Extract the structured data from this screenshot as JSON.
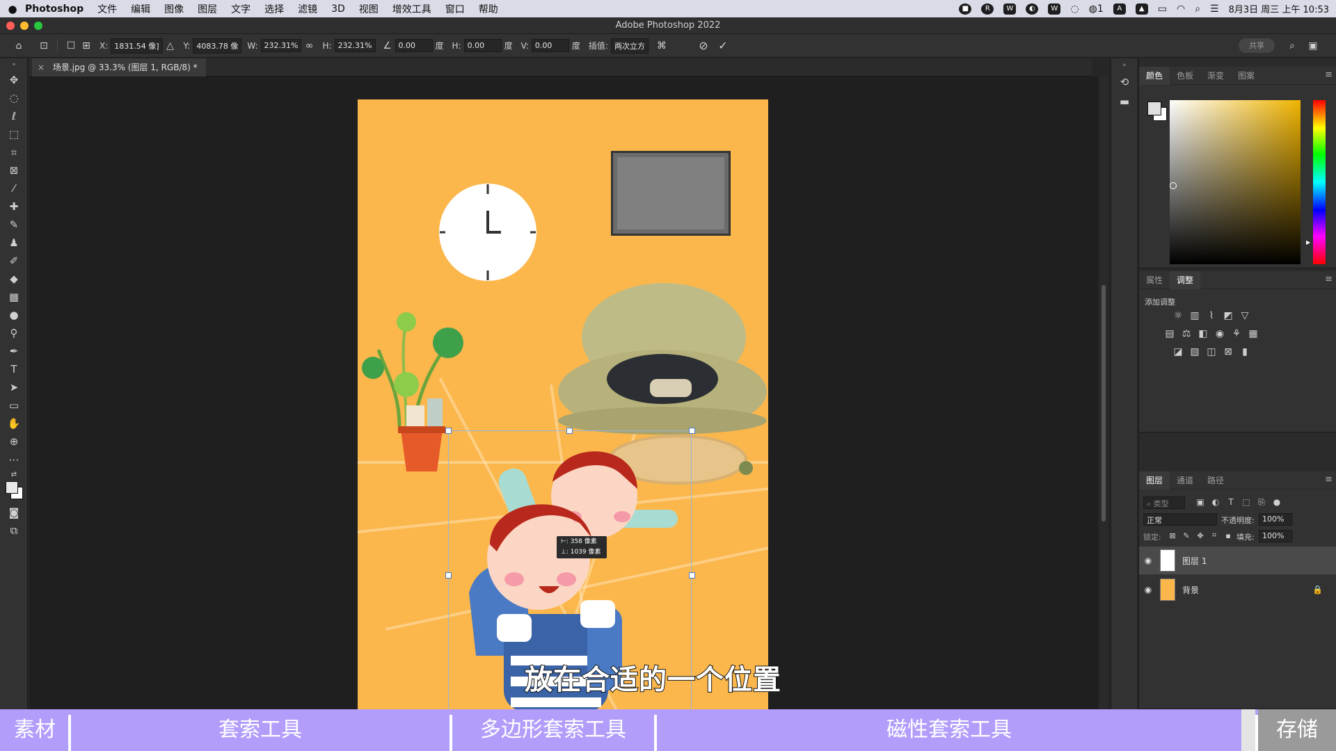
{
  "menubar": {
    "app_name": "Photoshop",
    "items": [
      "文件",
      "编辑",
      "图像",
      "图层",
      "文字",
      "选择",
      "滤镜",
      "3D",
      "视图",
      "增效工具",
      "窗口",
      "帮助"
    ],
    "wechat_count": "1",
    "input_method": "A",
    "datetime": "8月3日 周三 上午 10:53"
  },
  "window": {
    "title": "Adobe Photoshop 2022"
  },
  "options": {
    "x_label": "X:",
    "x_value": "1831.54 像]",
    "y_label": "Y:",
    "y_value": "4083.78 像",
    "w_label": "W:",
    "w_value": "232.31%",
    "h_label": "H:",
    "h_value": "232.31%",
    "angle_value": "0.00",
    "angle_unit": "度",
    "hskew_label": "H:",
    "hskew_value": "0.00",
    "hskew_unit": "度",
    "vskew_label": "V:",
    "vskew_value": "0.00",
    "vskew_unit": "度",
    "interp_label": "插值:",
    "interp_value": "两次立方",
    "share_label": "共享"
  },
  "document": {
    "tab_title": "场景.jpg @ 33.3% (图层 1, RGB/8) *"
  },
  "transform_tip": {
    "line1": "⊢: 358 像素",
    "line2": "⊥: 1039 像素"
  },
  "subtitle": "放在合适的一个位置",
  "color_panel": {
    "tabs": [
      "颜色",
      "色板",
      "渐变",
      "图案"
    ],
    "active": 0
  },
  "adjust_panel": {
    "tabs": [
      "属性",
      "调整"
    ],
    "active": 1,
    "title": "添加调整"
  },
  "layers_panel": {
    "tabs": [
      "图层",
      "通道",
      "路径"
    ],
    "search_placeholder": "类型",
    "blend_mode": "正常",
    "opacity_label": "不透明度:",
    "opacity_value": "100%",
    "lock_label": "锁定:",
    "fill_label": "填充:",
    "fill_value": "100%",
    "layers": [
      {
        "name": "图层 1",
        "selected": true
      },
      {
        "name": "背景",
        "locked": true
      }
    ]
  },
  "bottom_bar": {
    "segments": [
      "素材",
      "套索工具",
      "多边形套索工具",
      "磁性套索工具",
      "存储"
    ],
    "color": "#b39dfb"
  },
  "colors": {
    "canvas_bg": "#fbb74c",
    "accent": "#b39dfb"
  }
}
